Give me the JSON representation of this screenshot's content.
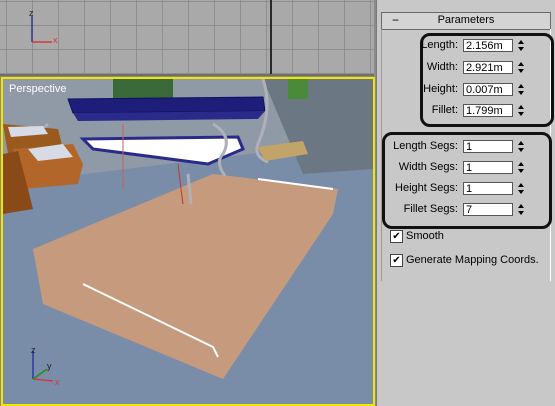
{
  "viewports": {
    "top_axis_z": "z",
    "top_axis_x": "x",
    "perspective_label": "Perspective",
    "persp_axis_z": "z",
    "persp_axis_x": "x",
    "persp_axis_y": "y",
    "selected_border_color": "#f2e600"
  },
  "rollout": {
    "collapse_symbol": "−",
    "title": "Parameters"
  },
  "params": [
    {
      "label": "Length:",
      "value": "2.156m"
    },
    {
      "label": "Width:",
      "value": "2.921m"
    },
    {
      "label": "Height:",
      "value": "0.007m"
    },
    {
      "label": "Fillet:",
      "value": "1.799m"
    }
  ],
  "segs": [
    {
      "label": "Length Segs:",
      "value": "1"
    },
    {
      "label": "Width Segs:",
      "value": "1"
    },
    {
      "label": "Height Segs:",
      "value": "1"
    },
    {
      "label": "Fillet Segs:",
      "value": "7"
    }
  ],
  "options": [
    {
      "label": "Smooth",
      "checked": true,
      "mark": "✔"
    },
    {
      "label": "Generate Mapping Coords.",
      "checked": true,
      "mark": "✔"
    }
  ]
}
